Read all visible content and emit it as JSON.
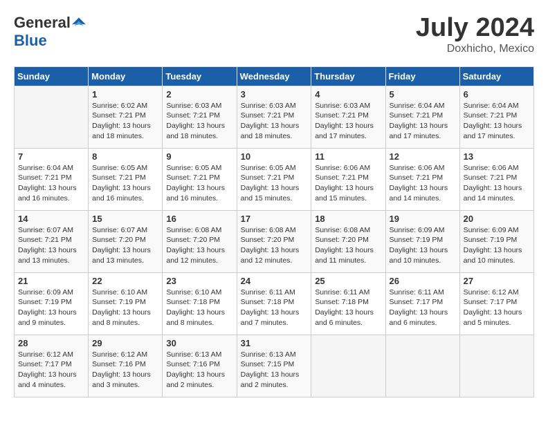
{
  "header": {
    "logo_general": "General",
    "logo_blue": "Blue",
    "month_title": "July 2024",
    "location": "Doxhicho, Mexico"
  },
  "calendar": {
    "weekdays": [
      "Sunday",
      "Monday",
      "Tuesday",
      "Wednesday",
      "Thursday",
      "Friday",
      "Saturday"
    ],
    "weeks": [
      [
        {
          "day": "",
          "sunrise": "",
          "sunset": "",
          "daylight": ""
        },
        {
          "day": "1",
          "sunrise": "6:02 AM",
          "sunset": "7:21 PM",
          "daylight": "13 hours and 18 minutes."
        },
        {
          "day": "2",
          "sunrise": "6:03 AM",
          "sunset": "7:21 PM",
          "daylight": "13 hours and 18 minutes."
        },
        {
          "day": "3",
          "sunrise": "6:03 AM",
          "sunset": "7:21 PM",
          "daylight": "13 hours and 18 minutes."
        },
        {
          "day": "4",
          "sunrise": "6:03 AM",
          "sunset": "7:21 PM",
          "daylight": "13 hours and 17 minutes."
        },
        {
          "day": "5",
          "sunrise": "6:04 AM",
          "sunset": "7:21 PM",
          "daylight": "13 hours and 17 minutes."
        },
        {
          "day": "6",
          "sunrise": "6:04 AM",
          "sunset": "7:21 PM",
          "daylight": "13 hours and 17 minutes."
        }
      ],
      [
        {
          "day": "7",
          "sunrise": "6:04 AM",
          "sunset": "7:21 PM",
          "daylight": "13 hours and 16 minutes."
        },
        {
          "day": "8",
          "sunrise": "6:05 AM",
          "sunset": "7:21 PM",
          "daylight": "13 hours and 16 minutes."
        },
        {
          "day": "9",
          "sunrise": "6:05 AM",
          "sunset": "7:21 PM",
          "daylight": "13 hours and 16 minutes."
        },
        {
          "day": "10",
          "sunrise": "6:05 AM",
          "sunset": "7:21 PM",
          "daylight": "13 hours and 15 minutes."
        },
        {
          "day": "11",
          "sunrise": "6:06 AM",
          "sunset": "7:21 PM",
          "daylight": "13 hours and 15 minutes."
        },
        {
          "day": "12",
          "sunrise": "6:06 AM",
          "sunset": "7:21 PM",
          "daylight": "13 hours and 14 minutes."
        },
        {
          "day": "13",
          "sunrise": "6:06 AM",
          "sunset": "7:21 PM",
          "daylight": "13 hours and 14 minutes."
        }
      ],
      [
        {
          "day": "14",
          "sunrise": "6:07 AM",
          "sunset": "7:21 PM",
          "daylight": "13 hours and 13 minutes."
        },
        {
          "day": "15",
          "sunrise": "6:07 AM",
          "sunset": "7:20 PM",
          "daylight": "13 hours and 13 minutes."
        },
        {
          "day": "16",
          "sunrise": "6:08 AM",
          "sunset": "7:20 PM",
          "daylight": "13 hours and 12 minutes."
        },
        {
          "day": "17",
          "sunrise": "6:08 AM",
          "sunset": "7:20 PM",
          "daylight": "13 hours and 12 minutes."
        },
        {
          "day": "18",
          "sunrise": "6:08 AM",
          "sunset": "7:20 PM",
          "daylight": "13 hours and 11 minutes."
        },
        {
          "day": "19",
          "sunrise": "6:09 AM",
          "sunset": "7:19 PM",
          "daylight": "13 hours and 10 minutes."
        },
        {
          "day": "20",
          "sunrise": "6:09 AM",
          "sunset": "7:19 PM",
          "daylight": "13 hours and 10 minutes."
        }
      ],
      [
        {
          "day": "21",
          "sunrise": "6:09 AM",
          "sunset": "7:19 PM",
          "daylight": "13 hours and 9 minutes."
        },
        {
          "day": "22",
          "sunrise": "6:10 AM",
          "sunset": "7:19 PM",
          "daylight": "13 hours and 8 minutes."
        },
        {
          "day": "23",
          "sunrise": "6:10 AM",
          "sunset": "7:18 PM",
          "daylight": "13 hours and 8 minutes."
        },
        {
          "day": "24",
          "sunrise": "6:11 AM",
          "sunset": "7:18 PM",
          "daylight": "13 hours and 7 minutes."
        },
        {
          "day": "25",
          "sunrise": "6:11 AM",
          "sunset": "7:18 PM",
          "daylight": "13 hours and 6 minutes."
        },
        {
          "day": "26",
          "sunrise": "6:11 AM",
          "sunset": "7:17 PM",
          "daylight": "13 hours and 6 minutes."
        },
        {
          "day": "27",
          "sunrise": "6:12 AM",
          "sunset": "7:17 PM",
          "daylight": "13 hours and 5 minutes."
        }
      ],
      [
        {
          "day": "28",
          "sunrise": "6:12 AM",
          "sunset": "7:17 PM",
          "daylight": "13 hours and 4 minutes."
        },
        {
          "day": "29",
          "sunrise": "6:12 AM",
          "sunset": "7:16 PM",
          "daylight": "13 hours and 3 minutes."
        },
        {
          "day": "30",
          "sunrise": "6:13 AM",
          "sunset": "7:16 PM",
          "daylight": "13 hours and 2 minutes."
        },
        {
          "day": "31",
          "sunrise": "6:13 AM",
          "sunset": "7:15 PM",
          "daylight": "13 hours and 2 minutes."
        },
        {
          "day": "",
          "sunrise": "",
          "sunset": "",
          "daylight": ""
        },
        {
          "day": "",
          "sunrise": "",
          "sunset": "",
          "daylight": ""
        },
        {
          "day": "",
          "sunrise": "",
          "sunset": "",
          "daylight": ""
        }
      ]
    ]
  }
}
